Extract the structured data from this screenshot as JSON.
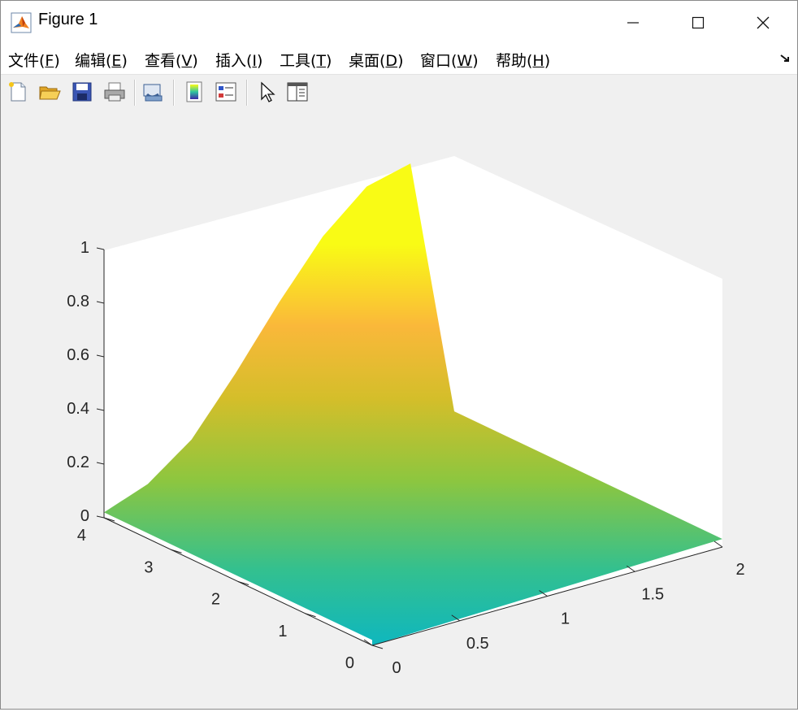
{
  "window": {
    "title": "Figure 1"
  },
  "menu": [
    {
      "label": "文件(",
      "key": "F",
      "end": ")"
    },
    {
      "label": "编辑(",
      "key": "E",
      "end": ")"
    },
    {
      "label": "查看(",
      "key": "V",
      "end": ")"
    },
    {
      "label": "插入(",
      "key": "I",
      "end": ")"
    },
    {
      "label": "工具(",
      "key": "T",
      "end": ")"
    },
    {
      "label": "桌面(",
      "key": "D",
      "end": ")"
    },
    {
      "label": "窗口(",
      "key": "W",
      "end": ")"
    },
    {
      "label": "帮助(",
      "key": "H",
      "end": ")"
    }
  ],
  "toolbar": {
    "icons": [
      "new-figure-icon",
      "open-file-icon",
      "save-icon",
      "print-icon",
      "link-plot-icon",
      "colorbar-icon",
      "legend-icon",
      "pointer-icon",
      "property-inspector-icon"
    ]
  },
  "chart_data": {
    "type": "surface",
    "colormap": "parula",
    "xlim": [
      0,
      2
    ],
    "ylim": [
      0,
      4
    ],
    "zlim": [
      0,
      1
    ],
    "x_ticks": [
      "0",
      "0.5",
      "1",
      "1.5",
      "2"
    ],
    "y_ticks": [
      "0",
      "1",
      "2",
      "3",
      "4"
    ],
    "z_ticks": [
      "0",
      "0.2",
      "0.4",
      "0.6",
      "0.8",
      "1"
    ],
    "grid": false,
    "z_profile": {
      "x": [
        0,
        0.25,
        0.5,
        0.75,
        1.0,
        1.25,
        1.5,
        1.75,
        2.0
      ],
      "z": [
        0.02,
        0.08,
        0.2,
        0.4,
        0.62,
        0.82,
        0.96,
        1.0,
        0.03
      ]
    }
  }
}
